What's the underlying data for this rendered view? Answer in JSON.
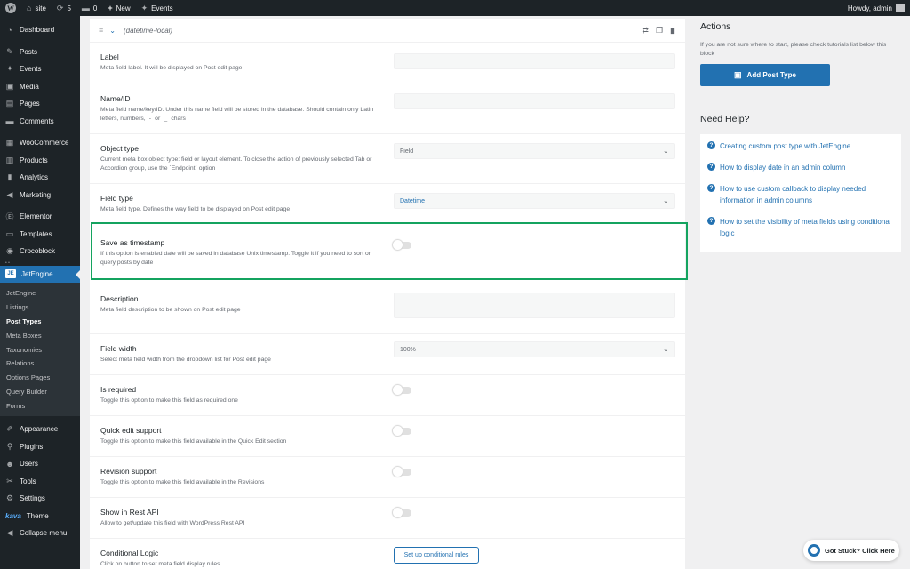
{
  "adminbar": {
    "site": "site",
    "updates": "5",
    "comments": "0",
    "new_label": "New",
    "events_label": "Events",
    "greeting": "Howdy, admin"
  },
  "sidebar": {
    "items_top": [
      {
        "label": "Dashboard",
        "icon": "dashboard-icon",
        "glyph": "◔"
      }
    ],
    "items_content": [
      {
        "label": "Posts",
        "icon": "pin-icon",
        "glyph": "✎"
      },
      {
        "label": "Events",
        "icon": "events-icon",
        "glyph": "✦"
      },
      {
        "label": "Media",
        "icon": "media-icon",
        "glyph": "▣"
      },
      {
        "label": "Pages",
        "icon": "pages-icon",
        "glyph": "▤"
      },
      {
        "label": "Comments",
        "icon": "comments-icon",
        "glyph": "▬"
      }
    ],
    "items_commerce": [
      {
        "label": "WooCommerce",
        "icon": "woocommerce-icon",
        "glyph": "▦"
      },
      {
        "label": "Products",
        "icon": "products-icon",
        "glyph": "▥"
      },
      {
        "label": "Analytics",
        "icon": "analytics-icon",
        "glyph": "▮"
      },
      {
        "label": "Marketing",
        "icon": "megaphone-icon",
        "glyph": "◀"
      }
    ],
    "items_builder": [
      {
        "label": "Elementor",
        "icon": "elementor-icon",
        "glyph": "Ⓔ"
      },
      {
        "label": "Templates",
        "icon": "templates-icon",
        "glyph": "▭"
      },
      {
        "label": "Crocoblock",
        "icon": "crocoblock-icon",
        "glyph": "◉"
      }
    ],
    "tiny_tag": "• •",
    "jetengine": "JetEngine",
    "submenu": [
      "JetEngine",
      "Listings",
      "Post Types",
      "Meta Boxes",
      "Taxonomies",
      "Relations",
      "Options Pages",
      "Query Builder",
      "Forms"
    ],
    "submenu_current": "Post Types",
    "items_bottom": [
      {
        "label": "Appearance",
        "icon": "appearance-icon",
        "glyph": "✐"
      },
      {
        "label": "Plugins",
        "icon": "plugins-icon",
        "glyph": "⚲"
      },
      {
        "label": "Users",
        "icon": "users-icon",
        "glyph": "☻"
      },
      {
        "label": "Tools",
        "icon": "tools-icon",
        "glyph": "✂"
      },
      {
        "label": "Settings",
        "icon": "settings-icon",
        "glyph": "⚙"
      }
    ],
    "kava_brand": "kava",
    "theme_label": "Theme",
    "collapse_label": "Collapse menu"
  },
  "panel": {
    "field_slug": "(datetime-local)",
    "rows": {
      "label": {
        "title": "Label",
        "desc": "Meta field label. It will be displayed on Post edit page"
      },
      "name": {
        "title": "Name/ID",
        "desc": "Meta field name/key/ID. Under this name field will be stored in the database. Should contain only Latin letters, numbers, `-` or `_` chars"
      },
      "object_type": {
        "title": "Object type",
        "desc": "Current meta box object type: field or layout element. To close the action of previously selected Tab or Accordion group, use the `Endpoint` option",
        "value": "Field"
      },
      "field_type": {
        "title": "Field type",
        "desc": "Meta field type. Defines the way field to be displayed on Post edit page",
        "value": "Datetime"
      },
      "timestamp": {
        "title": "Save as timestamp",
        "desc": "If this option is enabled date will be saved in database Unix timestamp. Toggle it if you need to sort or query posts by date"
      },
      "description": {
        "title": "Description",
        "desc": "Meta field description to be shown on Post edit page"
      },
      "width": {
        "title": "Field width",
        "desc": "Select meta field width from the dropdown list for Post edit page",
        "value": "100%"
      },
      "required": {
        "title": "Is required",
        "desc": "Toggle this option to make this field as required one"
      },
      "quick_edit": {
        "title": "Quick edit support",
        "desc": "Toggle this option to make this field available in the Quick Edit section"
      },
      "revision": {
        "title": "Revision support",
        "desc": "Toggle this option to make this field available in the Revisions"
      },
      "rest": {
        "title": "Show in Rest API",
        "desc": "Allow to get/update this field with WordPress Rest API"
      },
      "conditional": {
        "title": "Conditional Logic",
        "desc": "Click on button to set meta field display rules.",
        "button": "Set up conditional rules"
      }
    }
  },
  "right": {
    "actions_title": "Actions",
    "actions_desc": "If you are not sure where to start, please check tutorials list below this block",
    "add_button": "Add Post Type",
    "help_title": "Need Help?",
    "help_links": [
      "Creating custom post type with JetEngine",
      "How to display date in an admin column",
      "How to use custom callback to display needed information in admin columns",
      "How to set the visibility of meta fields using conditional logic"
    ]
  },
  "stuck_label": "Got Stuck? Click Here",
  "colors": {
    "accent": "#2271b1",
    "highlight": "#14a35f",
    "sidebar": "#1d2327"
  }
}
